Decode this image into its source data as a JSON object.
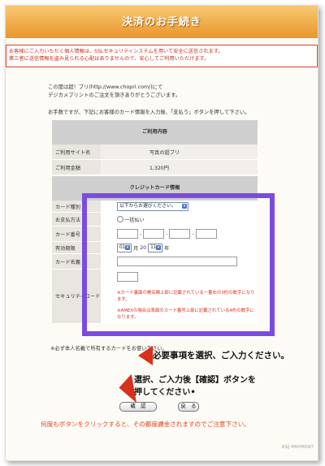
{
  "title": "決済のお手続き",
  "notice": {
    "line1": "お客様にご入力いただく個人情報は、SSLセキュリティシステムを用いて安全に送信されます。",
    "line2": "第三者に送信情報を盗み見られる心配はありませんので、安心してご利用いただけます。"
  },
  "intro": {
    "line1": "この度は超！プリ(http://www.chopri.com/)にて",
    "line2": "デジカメプリントのご注文を頂きありがとうございます。",
    "line3": "お手数ですが、下記にお客様のカード情報を入力後、「支払う」ボタンを押して下さい。"
  },
  "usage": {
    "header": "ご利用内容",
    "site_label": "ご利用サイト名",
    "site_value": "写真の超プリ",
    "amount_label": "ご利用金額",
    "amount_value": "1,320円"
  },
  "card": {
    "header": "クレジットカード情報",
    "type_label": "カード種別",
    "type_select": "以下からお選びください。",
    "method_label": "お支払方法",
    "method_option": "一括払い",
    "number_label": "カード番号",
    "expiry_label": "有効期限",
    "expiry_month": "01",
    "month_unit": "月",
    "year_prefix": "20",
    "expiry_year": "11",
    "year_unit": "年",
    "name_label": "カード名義",
    "security_label": "セキュリティコード",
    "security_note1": "※カード裏面の署名欄上部に記載されている一番右の3桁の数字になります。",
    "security_note2": "※AMEXの場合は表面のカード番号上部に記載されている4桁の数字になります。"
  },
  "name_note": "※必ず本人名義で所有するカードをお使い下さい。",
  "callout1": "必要事項を選択、ご入力ください。",
  "callout2_line1": "選択、ご入力後【確認】ボタンを",
  "callout2_line2": "押してください•",
  "confirm_button": "確　認",
  "back_button": "戻　る",
  "footer_note": "何度もボタンをクリックすると、その都度課金されますのでご注意下さい。",
  "brand": "ASJ PAYMENT",
  "colors": {
    "accent_purple": "#7a4be0",
    "title_orange": "#e9962b",
    "warning_red": "#d8301c"
  }
}
